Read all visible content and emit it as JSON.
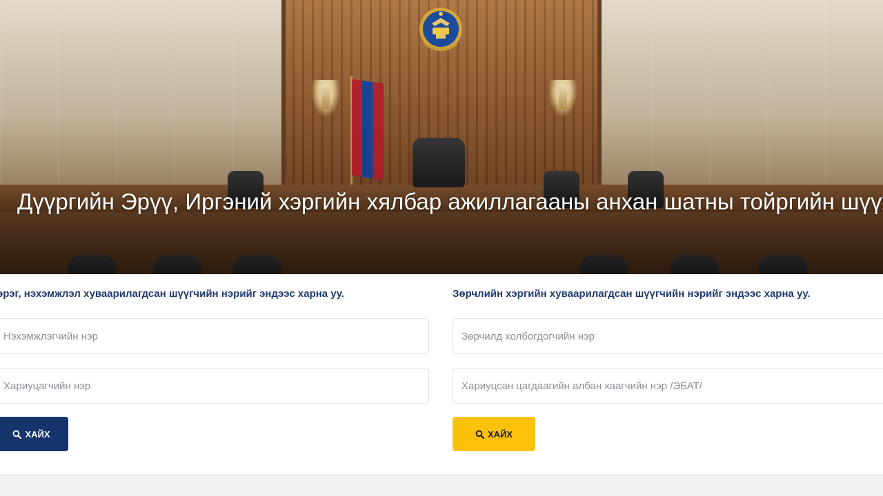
{
  "hero": {
    "title": "Дүүргийн Эрүү, Иргэний хэргийн хялбар ажиллагааны анхан шатны тойргийн шүүх"
  },
  "civil": {
    "heading": "эрэг, нэхэмжлэл хуваарилагдсан шүүгчийн нэрийг эндээс харна уу.",
    "plaintiff_placeholder": "Нэхэмжлэгчийн нэр",
    "defendant_placeholder": "Хариуцагчийн нэр",
    "search_label": "ХАЙХ"
  },
  "violation": {
    "heading": "Зөрчлийн хэргийн хуваарилагдсан шүүгчийн нэрийг эндээс харна уу.",
    "party_placeholder": "Зөрчилд холбогдогчийн нэр",
    "officer_placeholder": "Хариуцсан цагдаагийн албан хаагчийн нэр /ЭБАТ/",
    "search_label": "ХАЙХ"
  },
  "colors": {
    "primary_button": "#15346b",
    "secondary_button": "#fcc20b",
    "heading_text": "#1f3a6e"
  },
  "icons": {
    "search": "search-icon",
    "emblem": "state-emblem-icon"
  }
}
